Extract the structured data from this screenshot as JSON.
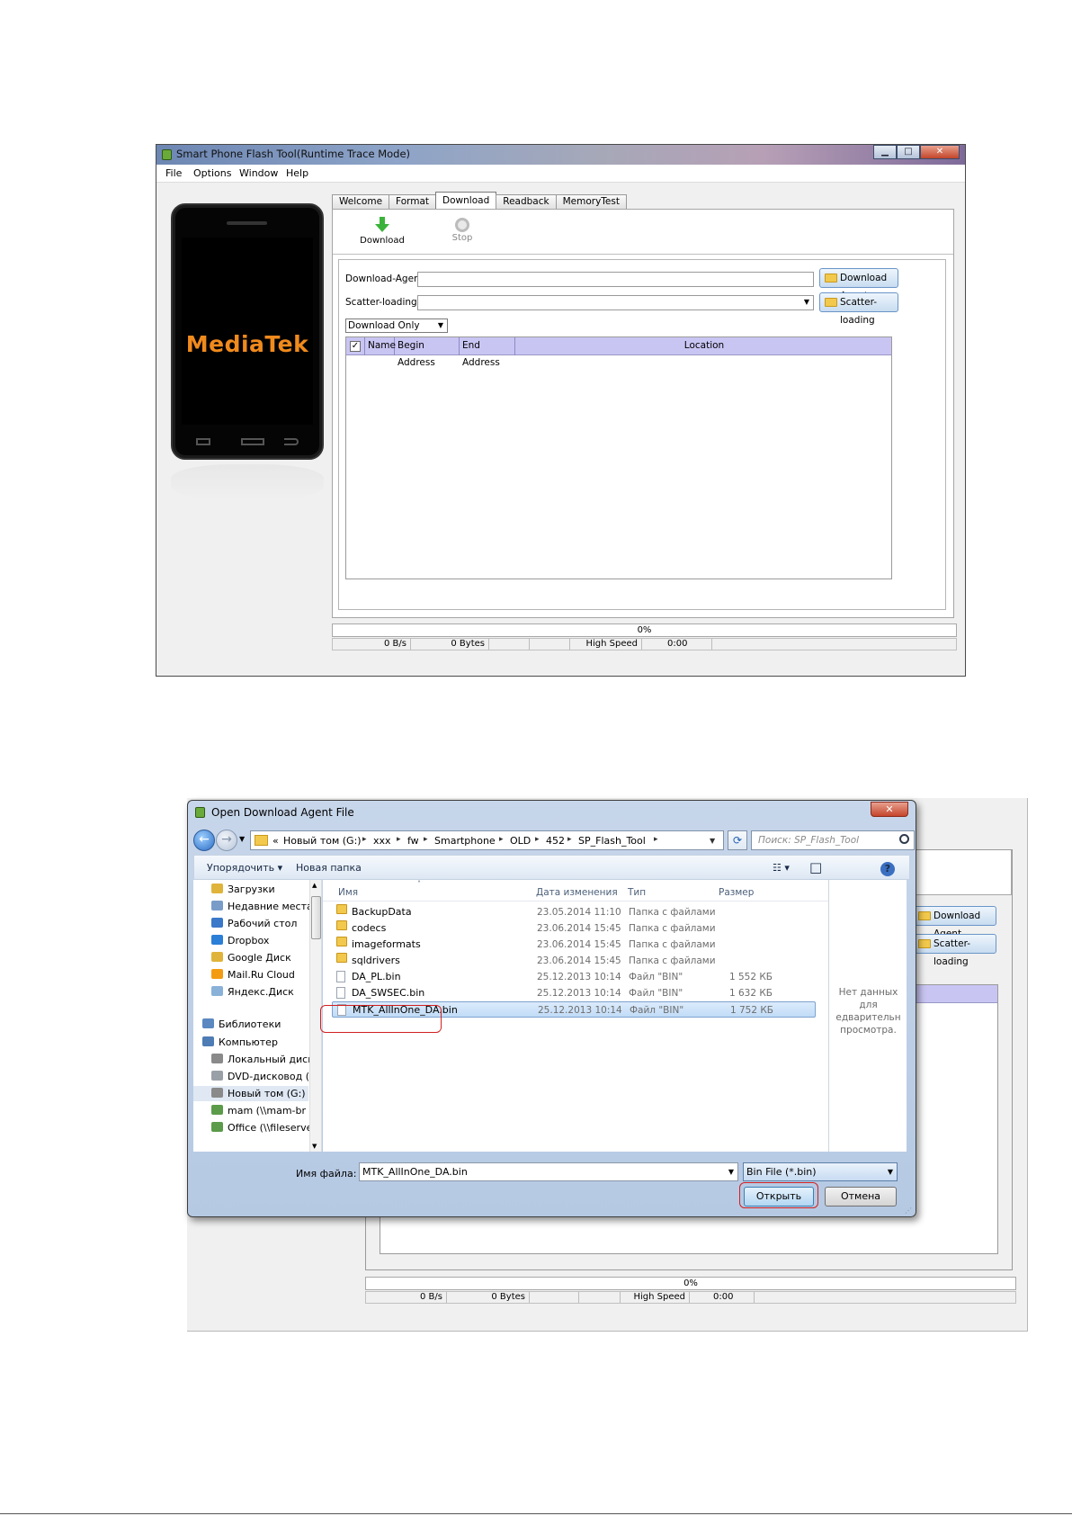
{
  "top_window": {
    "title": "Smart Phone Flash Tool(Runtime Trace Mode)",
    "menu": [
      "File",
      "Options",
      "Window",
      "Help"
    ],
    "phone_brand": "MediaTek",
    "tabs": [
      "Welcome",
      "Format",
      "Download",
      "Readback",
      "MemoryTest"
    ],
    "active_tab": "Download",
    "toolbar": {
      "download_label": "Download",
      "stop_label": "Stop"
    },
    "download_agent_label": "Download-Agent",
    "download_agent_value": "",
    "download_agent_button": "Download Agent",
    "scatter_label": "Scatter-loading File",
    "scatter_value": "",
    "scatter_button": "Scatter-loading",
    "mode_select": "Download Only",
    "grid_columns": [
      "Name",
      "Begin Address",
      "End Address",
      "Location"
    ],
    "progress_text": "0%",
    "status": {
      "speed": "0 B/s",
      "bytes": "0 Bytes",
      "mode": "High Speed",
      "time": "0:00"
    }
  },
  "bg_window": {
    "download_agent_button": "Download Agent",
    "scatter_button": "Scatter-loading",
    "progress_text": "0%",
    "status": {
      "speed": "0 B/s",
      "bytes": "0 Bytes",
      "mode": "High Speed",
      "time": "0:00"
    }
  },
  "dialog": {
    "title": "Open Download Agent File",
    "close_label": "✕",
    "breadcrumb_prefix": "«",
    "breadcrumb": [
      "Новый том (G:)",
      "xxx",
      "fw",
      "Smartphone",
      "OLD",
      "452",
      "SP_Flash_Tool"
    ],
    "search_placeholder": "Поиск: SP_Flash_Tool",
    "commands": {
      "organize": "Упорядочить ▾",
      "new_folder": "Новая папка"
    },
    "nav_items": [
      {
        "label": "Загрузки",
        "icon": "downloads-folder-icon",
        "color": "#e0b43a"
      },
      {
        "label": "Недавние места",
        "icon": "recent-places-icon",
        "color": "#7a9cc8"
      },
      {
        "label": "Рабочий стол",
        "icon": "desktop-icon",
        "color": "#3a78c9"
      },
      {
        "label": "Dropbox",
        "icon": "dropbox-icon",
        "color": "#2b7fd6"
      },
      {
        "label": "Google Диск",
        "icon": "google-drive-icon",
        "color": "#e0b43a"
      },
      {
        "label": "Mail.Ru Cloud",
        "icon": "mailru-cloud-icon",
        "color": "#f39c12"
      },
      {
        "label": "Яндекс.Диск",
        "icon": "yandex-disk-icon",
        "color": "#8ab1d8"
      },
      {
        "label": "Библиотеки",
        "icon": "libraries-icon",
        "color": "#5b88c0"
      },
      {
        "label": "Компьютер",
        "icon": "computer-icon",
        "color": "#4e7cb4"
      },
      {
        "label": "Локальный диск",
        "icon": "local-disk-icon",
        "color": "#8a8a8a"
      },
      {
        "label": "DVD-дисковод (E",
        "icon": "dvd-drive-icon",
        "color": "#9aa0a8"
      },
      {
        "label": "Новый том (G:)",
        "icon": "drive-icon",
        "color": "#8a8a8a"
      },
      {
        "label": "mam (\\\\mam-br",
        "icon": "network-drive-icon",
        "color": "#5b9b4a"
      },
      {
        "label": "Office (\\\\fileserve",
        "icon": "network-drive-icon",
        "color": "#5b9b4a"
      }
    ],
    "columns": {
      "name": "Имя",
      "date": "Дата изменения",
      "type": "Тип",
      "size": "Размер"
    },
    "files": [
      {
        "name": "BackupData",
        "date": "23.05.2014 11:10",
        "type": "Папка с файлами",
        "size": "",
        "kind": "folder"
      },
      {
        "name": "codecs",
        "date": "23.06.2014 15:45",
        "type": "Папка с файлами",
        "size": "",
        "kind": "folder"
      },
      {
        "name": "imageformats",
        "date": "23.06.2014 15:45",
        "type": "Папка с файлами",
        "size": "",
        "kind": "folder"
      },
      {
        "name": "sqldrivers",
        "date": "23.06.2014 15:45",
        "type": "Папка с файлами",
        "size": "",
        "kind": "folder"
      },
      {
        "name": "DA_PL.bin",
        "date": "25.12.2013 10:14",
        "type": "Файл \"BIN\"",
        "size": "1 552 КБ",
        "kind": "file"
      },
      {
        "name": "DA_SWSEC.bin",
        "date": "25.12.2013 10:14",
        "type": "Файл \"BIN\"",
        "size": "1 632 КБ",
        "kind": "file"
      },
      {
        "name": "MTK_AllInOne_DA.bin",
        "date": "25.12.2013 10:14",
        "type": "Файл \"BIN\"",
        "size": "1 752 КБ",
        "kind": "file"
      }
    ],
    "selected_index": 6,
    "preview_lines": [
      "Нет данных",
      "для",
      "едварительн",
      "просмотра."
    ],
    "filename_label": "Имя файла:",
    "filename_value": "MTK_AllInOne_DA.bin",
    "filter_value": "Bin File (*.bin)",
    "open_button": "Открыть",
    "cancel_button": "Отмена"
  },
  "colors": {
    "highlight_red": "#d22020",
    "grid_header": "#c9c5f3",
    "brand_orange": "#f08a1c"
  }
}
